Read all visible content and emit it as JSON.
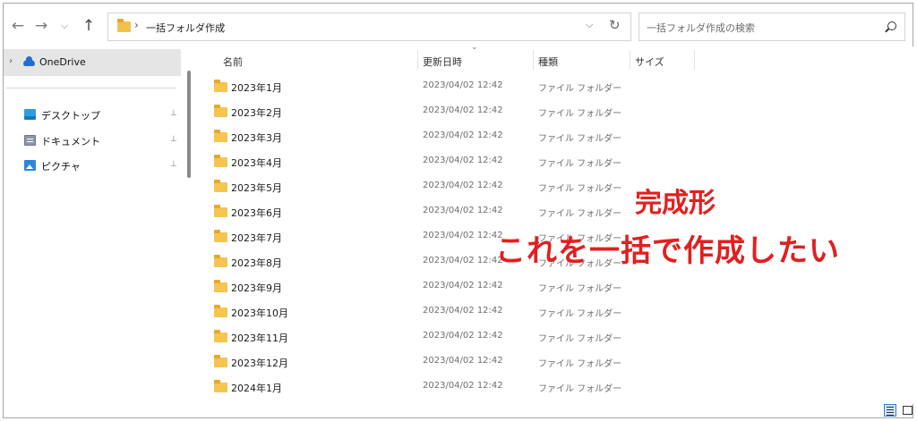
{
  "nav": {
    "back_icon": "arrow-left-icon",
    "forward_icon": "arrow-right-icon",
    "recent_icon": "chevron-down-icon",
    "up_icon": "arrow-up-icon"
  },
  "address": {
    "sep1": "›",
    "path": "一括フォルダ作成",
    "sep2": "›",
    "dropdown": "⌵",
    "refresh": "↻"
  },
  "search": {
    "placeholder": "一括フォルダ作成の検索"
  },
  "sidebar": {
    "expander": "›",
    "onedrive": "OneDrive",
    "quick": [
      {
        "label": "デスクトップ",
        "pin": "📌"
      },
      {
        "label": "ドキュメント",
        "pin": "📌"
      },
      {
        "label": "ピクチャ",
        "pin": "📌"
      }
    ]
  },
  "columns": {
    "name": "名前",
    "date": "更新日時",
    "type": "種類",
    "size": "サイズ",
    "sort_glyph": "⌄"
  },
  "rows": [
    {
      "name": "2023年1月",
      "date": "2023/04/02 12:42",
      "type": "ファイル フォルダー"
    },
    {
      "name": "2023年2月",
      "date": "2023/04/02 12:42",
      "type": "ファイル フォルダー"
    },
    {
      "name": "2023年3月",
      "date": "2023/04/02 12:42",
      "type": "ファイル フォルダー"
    },
    {
      "name": "2023年4月",
      "date": "2023/04/02 12:42",
      "type": "ファイル フォルダー"
    },
    {
      "name": "2023年5月",
      "date": "2023/04/02 12:42",
      "type": "ファイル フォルダー"
    },
    {
      "name": "2023年6月",
      "date": "2023/04/02 12:42",
      "type": "ファイル フォルダー"
    },
    {
      "name": "2023年7月",
      "date": "2023/04/02 12:42",
      "type": "ファイル フォルダー"
    },
    {
      "name": "2023年8月",
      "date": "2023/04/02 12:42",
      "type": "ファイル フォルダー"
    },
    {
      "name": "2023年9月",
      "date": "2023/04/02 12:42",
      "type": "ファイル フォルダー"
    },
    {
      "name": "2023年10月",
      "date": "2023/04/02 12:42",
      "type": "ファイル フォルダー"
    },
    {
      "name": "2023年11月",
      "date": "2023/04/02 12:42",
      "type": "ファイル フォルダー"
    },
    {
      "name": "2023年12月",
      "date": "2023/04/02 12:42",
      "type": "ファイル フォルダー"
    },
    {
      "name": "2024年1月",
      "date": "2023/04/02 12:42",
      "type": "ファイル フォルダー"
    }
  ],
  "annotation": {
    "line1": "完成形",
    "line2": "これを一括で作成したい",
    "color": "#e02020"
  },
  "colors": {
    "accent": "#1f6fd3",
    "folder": "#f5c54f",
    "selected_bg": "#e5e5e5"
  }
}
